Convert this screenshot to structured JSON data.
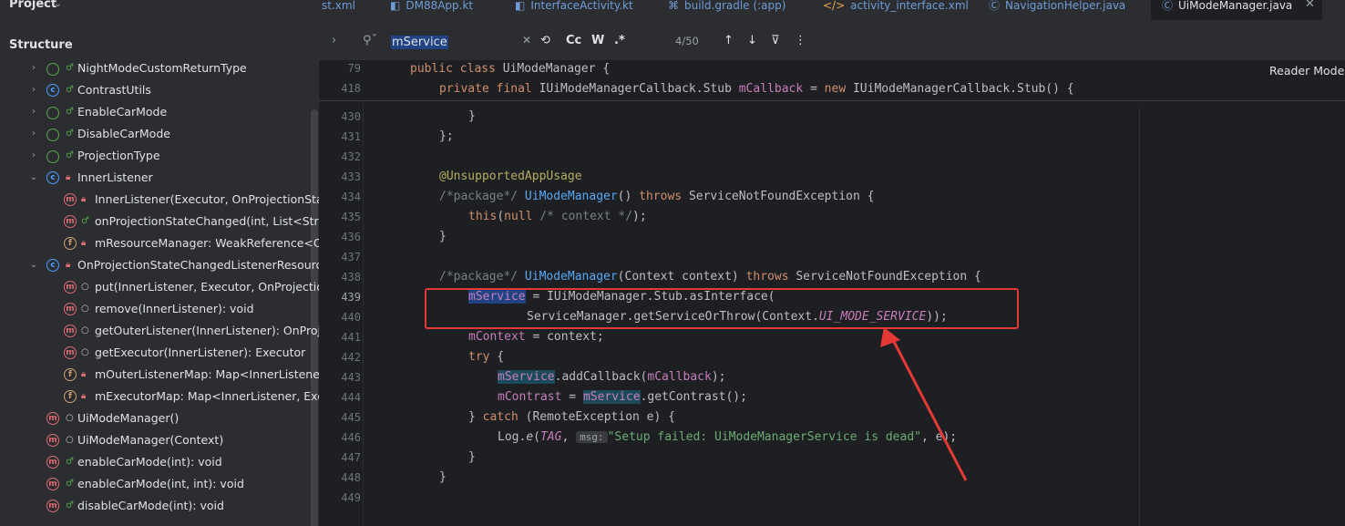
{
  "project_panel": {
    "title": "Project"
  },
  "structure_panel": {
    "title": "Structure",
    "items": [
      {
        "label": "NightModeCustomReturnType"
      },
      {
        "label": "ContrastUtils"
      },
      {
        "label": "EnableCarMode"
      },
      {
        "label": "DisableCarMode"
      },
      {
        "label": "ProjectionType"
      },
      {
        "label": "InnerListener"
      },
      {
        "label": "InnerListener(Executor, OnProjectionStateC"
      },
      {
        "label": "onProjectionStateChanged(int, List<String>"
      },
      {
        "label": "mResourceManager: WeakReference<OnP"
      },
      {
        "label": "OnProjectionStateChangedListenerResourceM"
      },
      {
        "label": "put(InnerListener, Executor, OnProjectionSt"
      },
      {
        "label": "remove(InnerListener): void"
      },
      {
        "label": "getOuterListener(InnerListener): OnProjecti"
      },
      {
        "label": "getExecutor(InnerListener): Executor"
      },
      {
        "label": "mOuterListenerMap: Map<InnerListener, C"
      },
      {
        "label": "mExecutorMap: Map<InnerListener, Execu"
      },
      {
        "label": "UiModeManager()"
      },
      {
        "label": "UiModeManager(Context)"
      },
      {
        "label": "enableCarMode(int): void"
      },
      {
        "label": "enableCarMode(int, int): void"
      },
      {
        "label": "disableCarMode(int): void"
      }
    ]
  },
  "tabs": [
    {
      "label": "st.xml"
    },
    {
      "label": "DM88App.kt"
    },
    {
      "label": "InterfaceActivity.kt"
    },
    {
      "label": "build.gradle (:app)"
    },
    {
      "label": "activity_interface.xml"
    },
    {
      "label": "NavigationHelper.java"
    },
    {
      "label": "UiModeManager.java",
      "active": true
    }
  ],
  "search": {
    "query": "mService",
    "match_case": "Cc",
    "words": "W",
    "regex": ".*",
    "result_count": "4/50"
  },
  "editor": {
    "reader_mode": "Reader Mode",
    "line_numbers": [
      "79",
      "418",
      "430",
      "431",
      "432",
      "433",
      "434",
      "435",
      "436",
      "437",
      "438",
      "439",
      "440",
      "441",
      "442",
      "443",
      "444",
      "445",
      "446",
      "447",
      "448",
      "449"
    ],
    "inlay_hint": "msg:"
  },
  "colors": {
    "annotation_box": "#e53935",
    "search_highlight": "#214283",
    "keyword": "#cf8e6d",
    "method": "#56a8f5",
    "field": "#c77dbb"
  }
}
